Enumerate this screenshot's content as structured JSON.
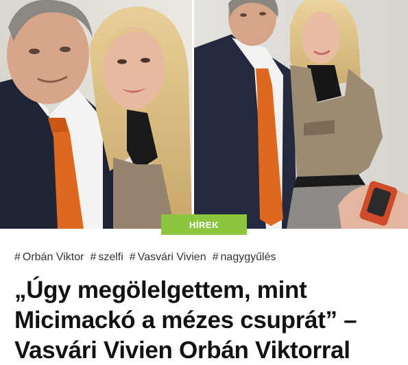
{
  "article": {
    "category": "HÍREK",
    "tags": [
      {
        "label": "Orbán Viktor"
      },
      {
        "label": "szelfi"
      },
      {
        "label": "Vasvári Vivien"
      },
      {
        "label": "nagygyűlés"
      }
    ],
    "tag_prefix": "#",
    "headline": "„Úgy megölelgettem, mint Micimackó a mézes csuprát” – Vasvári Vivien Orbán Viktorral"
  },
  "colors": {
    "badge_background": "#8cc63f",
    "badge_text": "#ffffff",
    "headline_text": "#111111",
    "tag_text": "#333333",
    "tie_orange": "#e0681e"
  },
  "icons": {
    "left_photo": "selfie-photo",
    "right_photo": "standing-photo"
  }
}
